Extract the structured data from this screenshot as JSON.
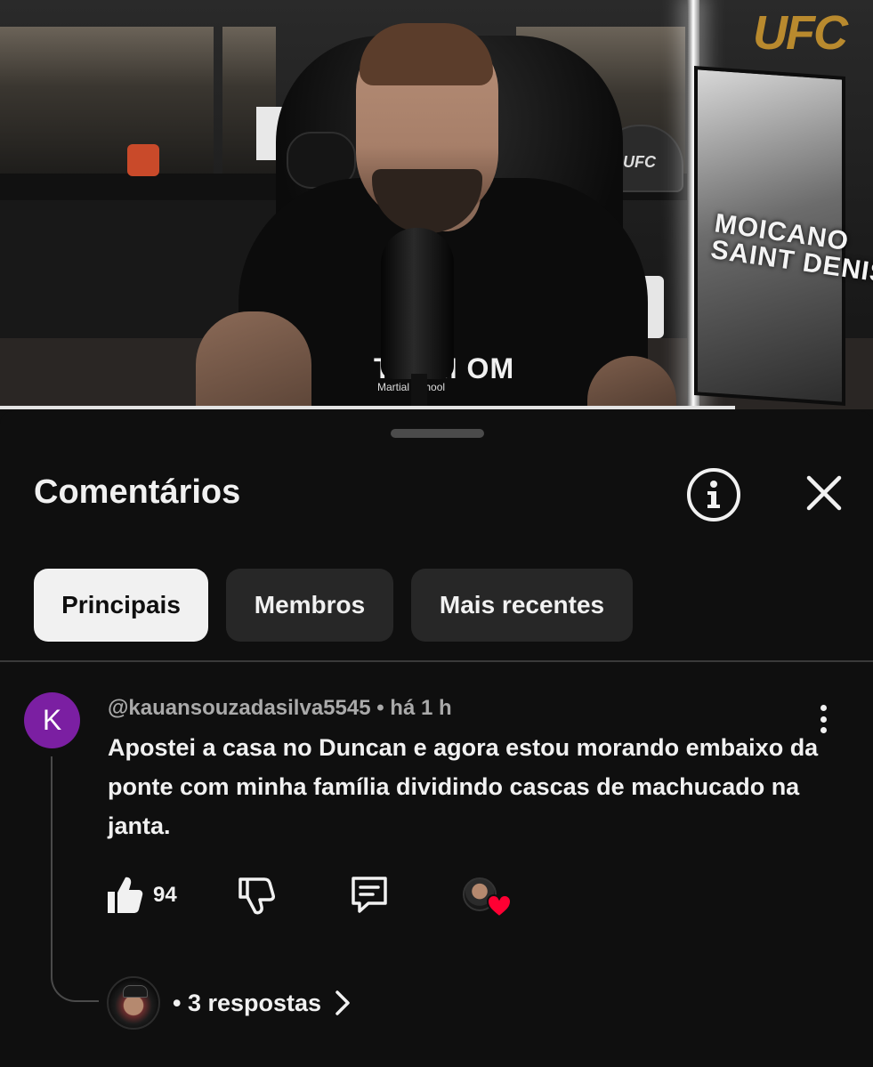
{
  "video": {
    "cap_text": "UFC",
    "sign_text": "UFC",
    "poster_text": "MOICANO\nSAINT DENIS",
    "shirt_text": "TEAM OM",
    "shirt_sub": "Martial School",
    "progress_fraction": 0.842
  },
  "sheet": {
    "title": "Comentários",
    "info_icon": "info-icon",
    "close_icon": "close-icon",
    "chips": [
      {
        "label": "Principais",
        "active": true
      },
      {
        "label": "Membros",
        "active": false
      },
      {
        "label": "Mais recentes",
        "active": false
      }
    ]
  },
  "comment": {
    "avatar_letter": "K",
    "avatar_color": "#7b1fa2",
    "meta": "@kauansouzadasilva5545 • há 1 h",
    "text": "Apostei a casa no Duncan e agora estou morando embaixo da ponte com minha família dividindo cascas de machucado na janta.",
    "likes": "94",
    "heart_color": "#ff0033",
    "replies_label": "• 3 respostas"
  }
}
